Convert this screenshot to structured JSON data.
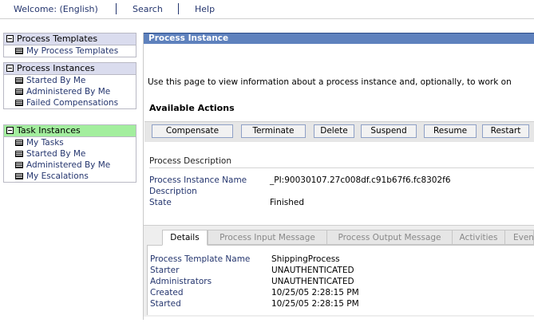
{
  "topnav": {
    "welcome": "Welcome: (English)",
    "search": "Search",
    "help": "Help"
  },
  "nav": {
    "process_templates": {
      "title": "Process Templates",
      "items": [
        "My Process Templates"
      ]
    },
    "process_instances": {
      "title": "Process Instances",
      "items": [
        "Started By Me",
        "Administered By Me",
        "Failed Compensations"
      ]
    },
    "task_instances": {
      "title": "Task Instances",
      "items": [
        "My Tasks",
        "Started By Me",
        "Administered By Me",
        "My Escalations"
      ]
    }
  },
  "main": {
    "title": "Process Instance",
    "intro": "Use this page to view information about a process instance and, optionally, to work on",
    "available_actions": "Available Actions",
    "actions": [
      "Compensate",
      "Terminate",
      "Delete",
      "Suspend",
      "Resume",
      "Restart"
    ],
    "description_section": "Process Description",
    "details": [
      {
        "label": "Process Instance Name",
        "value": "_PI:90030107.27c008df.c91b67f6.fc8302f6"
      },
      {
        "label": "Description",
        "value": ""
      },
      {
        "label": "State",
        "value": "Finished"
      }
    ],
    "tabs": [
      "Details",
      "Process Input Message",
      "Process Output Message",
      "Activities",
      "Even"
    ],
    "tab_details": [
      {
        "label": "Process Template Name",
        "value": "ShippingProcess"
      },
      {
        "label": "Starter",
        "value": "UNAUTHENTICATED"
      },
      {
        "label": "Administrators",
        "value": "UNAUTHENTICATED"
      },
      {
        "label": "Created",
        "value": "10/25/05 2:28:15 PM"
      },
      {
        "label": "Started",
        "value": "10/25/05 2:28:15 PM"
      }
    ]
  }
}
